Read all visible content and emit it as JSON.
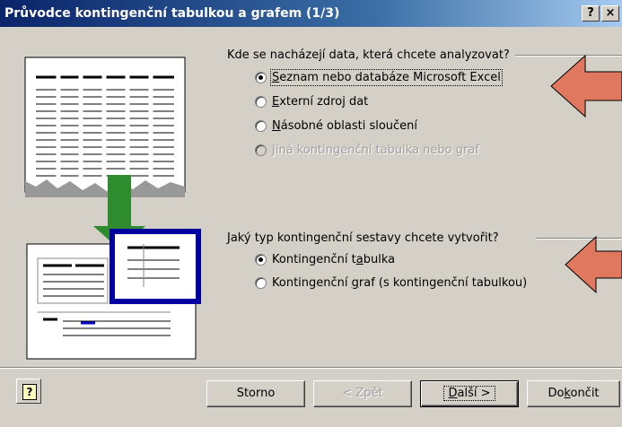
{
  "window": {
    "title": "Průvodce kontingenční tabulkou a grafem (1/3)",
    "help_label": "?",
    "close_label": "×"
  },
  "source_group": {
    "label": "Kde se nacházejí data, která chcete analyzovat?",
    "options": [
      {
        "first": "S",
        "rest": "eznam nebo databáze Microsoft Excel",
        "checked": true,
        "disabled": false
      },
      {
        "first": "E",
        "rest": "xterní zdroj dat",
        "checked": false,
        "disabled": false
      },
      {
        "first": "N",
        "rest": "ásobné oblasti sloučení",
        "checked": false,
        "disabled": false
      },
      {
        "first": "",
        "rest": "Jiná kontingenční tabulka nebo graf",
        "checked": false,
        "disabled": true
      }
    ]
  },
  "report_group": {
    "label": "Jaký typ kontingenční sestavy chcete vytvořit?",
    "options": [
      {
        "pre": "Kontingenční t",
        "u": "a",
        "post": "bulka",
        "checked": true
      },
      {
        "pre": "Kontingenční ",
        "u": "g",
        "post": "raf (s kontingenční tabulkou)",
        "checked": false
      }
    ]
  },
  "buttons": {
    "cancel": "Storno",
    "back": "< Zpět",
    "next_u": "D",
    "next_rest": "alší >",
    "finish_pre": "Do",
    "finish_u": "k",
    "finish_post": "ončit"
  },
  "help_icon": "?",
  "colors": {
    "title_bar": "#0a246a",
    "arrow_fill": "#e07860",
    "green_arrow": "#2e8b2e",
    "highlight_frame": "#0000a0"
  }
}
